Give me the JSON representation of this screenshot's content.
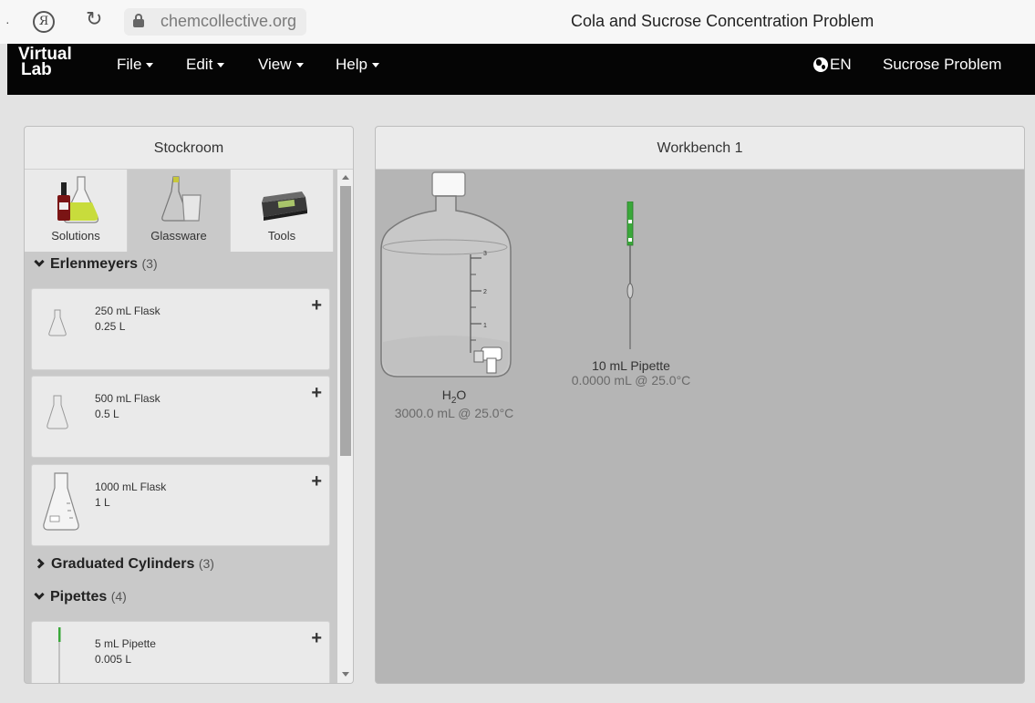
{
  "browser": {
    "yandex_glyph": "Я",
    "url": "chemcollective.org",
    "page_title": "Cola and Sucrose Concentration Problem"
  },
  "navbar": {
    "logo_line1": "Virtual",
    "logo_line2": "Lab",
    "menus": [
      "File",
      "Edit",
      "View",
      "Help"
    ],
    "language": "EN",
    "problem": "Sucrose Problem"
  },
  "stockroom": {
    "title": "Stockroom",
    "tabs": [
      {
        "label": "Solutions"
      },
      {
        "label": "Glassware",
        "active": true
      },
      {
        "label": "Tools"
      }
    ],
    "sections": [
      {
        "title": "Erlenmeyers",
        "count": "(3)",
        "expanded": true,
        "items": [
          {
            "name": "250 mL Flask",
            "volume": "0.25 L"
          },
          {
            "name": "500 mL Flask",
            "volume": "0.5 L"
          },
          {
            "name": "1000 mL Flask",
            "volume": "1 L"
          }
        ]
      },
      {
        "title": "Graduated Cylinders",
        "count": "(3)",
        "expanded": false
      },
      {
        "title": "Pipettes",
        "count": "(4)",
        "expanded": true,
        "items": [
          {
            "name": "5 mL Pipette",
            "volume": "0.005 L"
          }
        ]
      }
    ],
    "add_symbol": "+"
  },
  "workbench": {
    "title": "Workbench 1",
    "objects": [
      {
        "name_main": "H",
        "name_sub": "2",
        "name_tail": "O",
        "detail": "3000.0 mL @ 25.0°C",
        "scale_marks": [
          "3",
          "2",
          "1"
        ]
      },
      {
        "name": "10 mL Pipette",
        "detail": "0.0000 mL @ 25.0°C"
      }
    ]
  },
  "colors": {
    "navbar": "#050505",
    "workbench_bg": "#b5b5b5",
    "stockroom_bg": "#c9c9c9",
    "pipette_green": "#3aa83a"
  }
}
